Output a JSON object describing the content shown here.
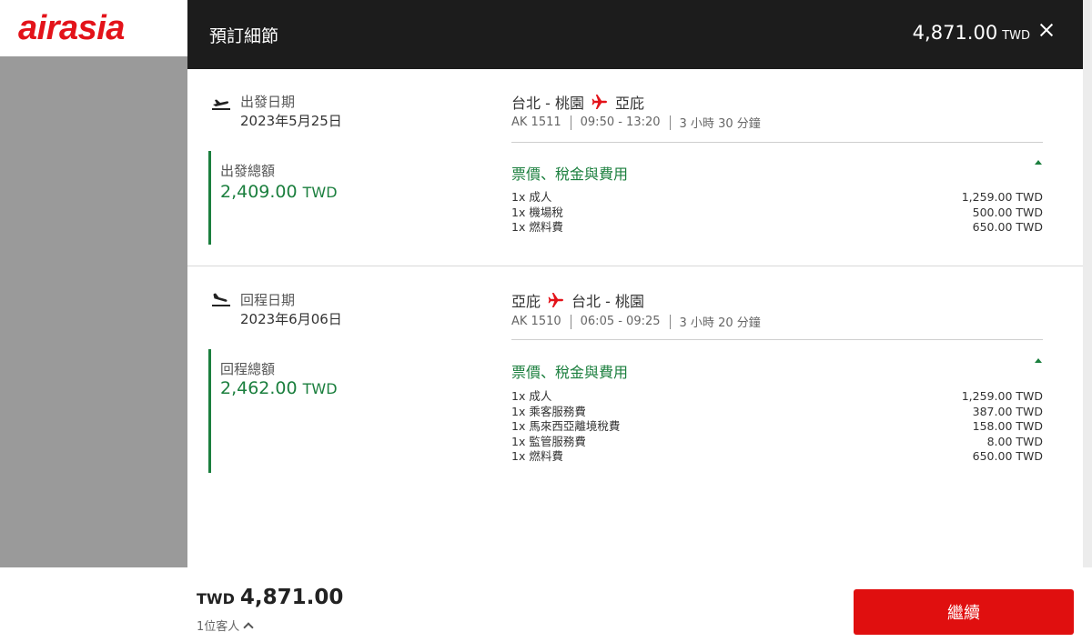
{
  "app": {
    "logo_text": "airasia",
    "brand_color": "#e3131a"
  },
  "modal": {
    "title": "預訂細節",
    "total_amount": "4,871.00",
    "total_currency": "TWD",
    "close_icon": "close-icon"
  },
  "legs": [
    {
      "label": "出發日期",
      "date": "2023年5月25日",
      "icon": "takeoff-icon",
      "total_label": "出發總額",
      "total_amount": "2,409.00",
      "total_currency": "TWD",
      "origin": "台北 - 桃園",
      "destination": "亞庇",
      "flight_no": "AK 1511",
      "time": "09:50 - 13:20",
      "duration": "3 小時 30 分鐘",
      "fees_title": "票價、稅金與費用",
      "fees": [
        {
          "name": "1x 成人",
          "amount": "1,259.00 TWD"
        },
        {
          "name": "1x 機場稅",
          "amount": "500.00 TWD"
        },
        {
          "name": "1x 燃料費",
          "amount": "650.00 TWD"
        }
      ]
    },
    {
      "label": "回程日期",
      "date": "2023年6月06日",
      "icon": "landing-icon",
      "total_label": "回程總額",
      "total_amount": "2,462.00",
      "total_currency": "TWD",
      "origin": "亞庇",
      "destination": "台北 - 桃園",
      "flight_no": "AK 1510",
      "time": "06:05 - 09:25",
      "duration": "3 小時 20 分鐘",
      "fees_title": "票價、稅金與費用",
      "fees": [
        {
          "name": "1x 成人",
          "amount": "1,259.00 TWD"
        },
        {
          "name": "1x 乘客服務費",
          "amount": "387.00 TWD"
        },
        {
          "name": "1x 馬來西亞離境稅費",
          "amount": "158.00 TWD"
        },
        {
          "name": "1x 監管服務費",
          "amount": "8.00 TWD"
        },
        {
          "name": "1x 燃料費",
          "amount": "650.00 TWD"
        }
      ]
    }
  ],
  "footer": {
    "currency": "TWD",
    "amount": "4,871.00",
    "guests": "1位客人",
    "continue_label": "繼續",
    "button_color": "#e00f0f"
  },
  "colors": {
    "accent_green": "#1b7f3e",
    "header_dark": "#1c1c1c"
  }
}
